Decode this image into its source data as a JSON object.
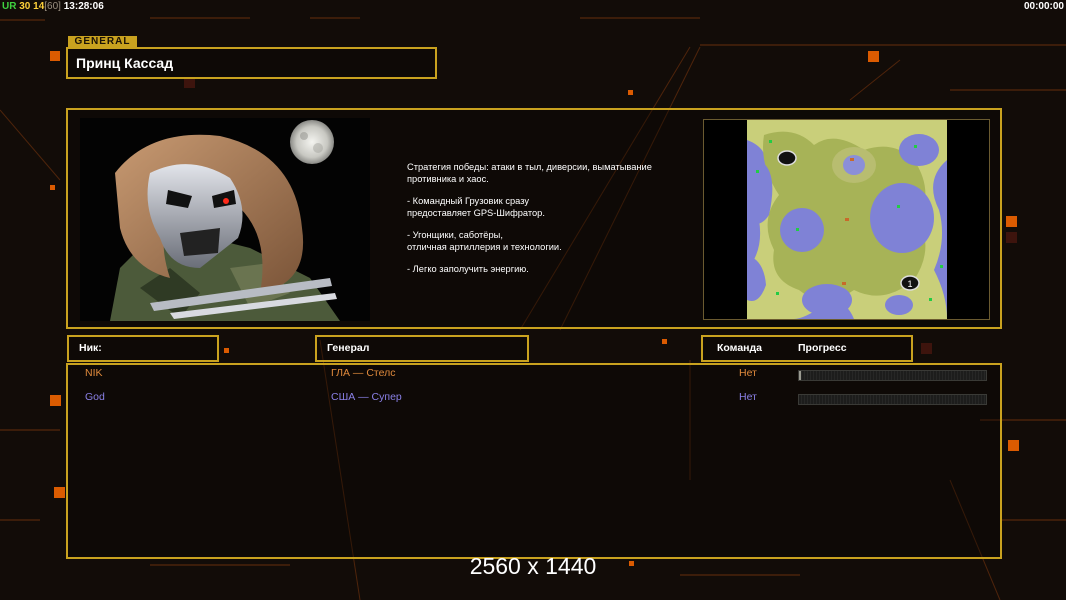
{
  "hud": {
    "ur_label": "UR",
    "fps": "30",
    "fps_current": "14",
    "fps_max": "[60]",
    "clock": "13:28:06",
    "timer": "00:00:00"
  },
  "general": {
    "tag": "GENERAL",
    "name": "Принц Кассад",
    "description": [
      "Стратегия победы: атаки в тыл, диверсии, выматывание\n противника и хаос.",
      "- Командный Грузовик сразу\nпредоставляет GPS-Шифратор.",
      "- Угонщики, саботёры,\nотличная артиллерия и технологии.",
      "- Легко заполучить энергию."
    ]
  },
  "minimap": {
    "start_position_label": "1"
  },
  "columns": {
    "nick": "Ник:",
    "general": "Генерал",
    "team": "Команда",
    "progress": "Прогресс"
  },
  "players": [
    {
      "nick": "NIK",
      "general": "ГЛА — Стелс",
      "team": "Нет",
      "color": "#e08a3c",
      "progress": 0.01
    },
    {
      "nick": "God",
      "general": "США — Супер",
      "team": "Нет",
      "color": "#8a80e6",
      "progress": 0
    }
  ],
  "resolution_text": "2560 x 1440",
  "colors": {
    "accent": "#c9a21f",
    "deco_orange": "#ff6a00"
  }
}
